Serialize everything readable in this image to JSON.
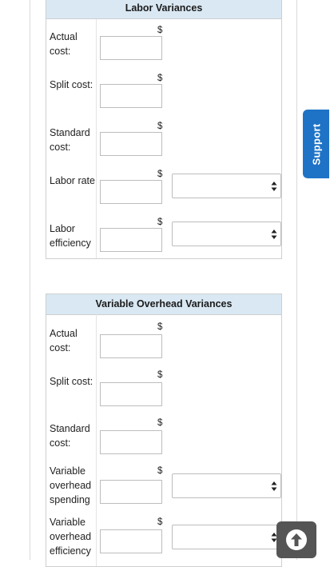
{
  "labor": {
    "title": "Labor Variances",
    "rows": [
      {
        "label": "Actual cost:",
        "currency": "$",
        "amount": "",
        "has_select": false
      },
      {
        "label": "Split cost:",
        "currency": "$",
        "amount": "",
        "has_select": false
      },
      {
        "label": "Standard cost:",
        "currency": "$",
        "amount": "",
        "has_select": false
      },
      {
        "label": "Labor rate",
        "currency": "$",
        "amount": "",
        "has_select": true,
        "select_value": ""
      },
      {
        "label": "Labor efficiency",
        "currency": "$",
        "amount": "",
        "has_select": true,
        "select_value": ""
      }
    ]
  },
  "variable_overhead": {
    "title": "Variable Overhead Variances",
    "rows": [
      {
        "label": "Actual cost:",
        "currency": "$",
        "amount": "",
        "has_select": false
      },
      {
        "label": "Split cost:",
        "currency": "$",
        "amount": "",
        "has_select": false
      },
      {
        "label": "Standard cost:",
        "currency": "$",
        "amount": "",
        "has_select": false
      },
      {
        "label": "Variable overhead spending",
        "currency": "$",
        "amount": "",
        "has_select": true,
        "select_value": ""
      },
      {
        "label": "Variable overhead efficiency",
        "currency": "$",
        "amount": "",
        "has_select": true,
        "select_value": ""
      }
    ]
  },
  "support_tab": {
    "label": "Support"
  },
  "icons": {
    "select_arrows": "updown-arrows-icon",
    "scroll_top": "arrow-up-circle-icon"
  },
  "colors": {
    "header_bg": "#d9e8f3",
    "support_bg": "#1f73c6",
    "scroll_btn_bg": "#555555"
  }
}
